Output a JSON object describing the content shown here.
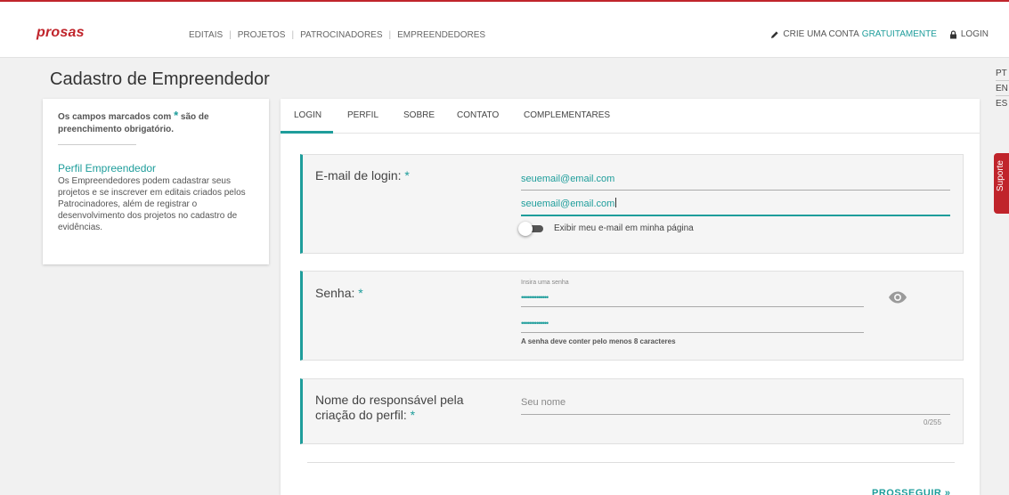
{
  "header": {
    "logo": "prosas",
    "nav": [
      {
        "label": "EDITAIS"
      },
      {
        "label": "PROJETOS"
      },
      {
        "label": "PATROCINADORES"
      },
      {
        "label": "EMPREENDEDORES"
      }
    ],
    "nav_separator": "|",
    "create_account_prefix": "CRIE UMA CONTA",
    "create_account_accent": "GRATUITAMENTE",
    "login": "LOGIN"
  },
  "languages": [
    "PT",
    "EN",
    "ES"
  ],
  "support_tab": "Suporte",
  "page_title": "Cadastro de Empreendedor",
  "info": {
    "required_prefix": "Os campos marcados com",
    "required_star": "*",
    "required_suffix": "são de preenchimento obrigatório.",
    "title": "Perfil Empreendedor",
    "text": "Os Empreendedores podem cadastrar seus projetos e se inscrever em editais criados pelos Patrocinadores, além de registrar o desenvolvimento dos projetos no cadastro de evidências."
  },
  "tabs": [
    {
      "label": "LOGIN",
      "active": true
    },
    {
      "label": "PERFIL"
    },
    {
      "label": "SOBRE"
    },
    {
      "label": "CONTATO"
    },
    {
      "label": "COMPLEMENTARES"
    }
  ],
  "sections": {
    "email": {
      "label": "E-mail de login:",
      "star": "*",
      "value": "seuemail@email.com",
      "confirm_value": "seuemail@email.com",
      "toggle_label": "Exibir meu e-mail em minha página",
      "toggle_on": false
    },
    "password": {
      "label": "Senha:",
      "star": "*",
      "mini_label": "Insira uma senha",
      "value_mask": "••••••••••••••",
      "confirm_mask": "••••••••••••••",
      "hint": "A senha deve conter pelo menos 8 caracteres",
      "eye_icon": "eye-icon"
    },
    "name": {
      "label_line1": "Nome do responsável pela",
      "label_line2": "criação do perfil:",
      "star": "*",
      "placeholder": "Seu nome",
      "counter": "0/255"
    }
  },
  "proceed": "PROSSEGUIR »",
  "colors": {
    "brand": "#c0242b",
    "accent": "#1e9d9b"
  }
}
